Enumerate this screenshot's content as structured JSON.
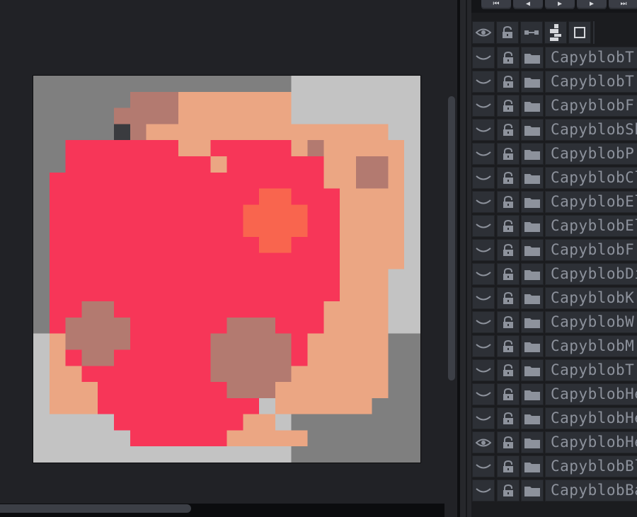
{
  "playback": {
    "buttons": [
      {
        "name": "first-frame",
        "glyph": "⏮"
      },
      {
        "name": "prev-frame",
        "glyph": "◀"
      },
      {
        "name": "play",
        "glyph": "▶"
      },
      {
        "name": "next-frame",
        "glyph": "▶"
      },
      {
        "name": "last-frame",
        "glyph": "⏭"
      }
    ]
  },
  "layers_header": {
    "icons": [
      "eye-icon",
      "lock-icon",
      "link-icon",
      "layers-toggle-icon",
      "frame-icon"
    ]
  },
  "layers": [
    {
      "name": "CapyblobT",
      "visible": false
    },
    {
      "name": "CapyblobT",
      "visible": false
    },
    {
      "name": "CapyblobFr",
      "visible": false
    },
    {
      "name": "CapyblobSh",
      "visible": false
    },
    {
      "name": "CapyblobP",
      "visible": false
    },
    {
      "name": "CapyblobCl",
      "visible": false
    },
    {
      "name": "CapyblobEl",
      "visible": false
    },
    {
      "name": "CapyblobEl",
      "visible": false
    },
    {
      "name": "CapyblobF",
      "visible": false
    },
    {
      "name": "CapyblobDi",
      "visible": false
    },
    {
      "name": "CapyblobKr",
      "visible": false
    },
    {
      "name": "CapyblobW",
      "visible": false
    },
    {
      "name": "CapyblobM",
      "visible": false
    },
    {
      "name": "CapyblobT",
      "visible": false
    },
    {
      "name": "CapyblobHe",
      "visible": false
    },
    {
      "name": "CapyblobHe",
      "visible": false
    },
    {
      "name": "CapyblobHe",
      "visible": true
    },
    {
      "name": "CapyblobBl",
      "visible": false
    },
    {
      "name": "CapyblobBa",
      "visible": false
    }
  ],
  "colors": {
    "bg_dark": "#7f7f7f",
    "bg_light": "#c3c3c3",
    "skin": "#eba683",
    "heart": "#f73658",
    "highlight": "#f9654e",
    "mauve": "#b37a70",
    "eye": "#3a3b3f",
    "panel": "#2d3036",
    "text": "#8d929c"
  }
}
